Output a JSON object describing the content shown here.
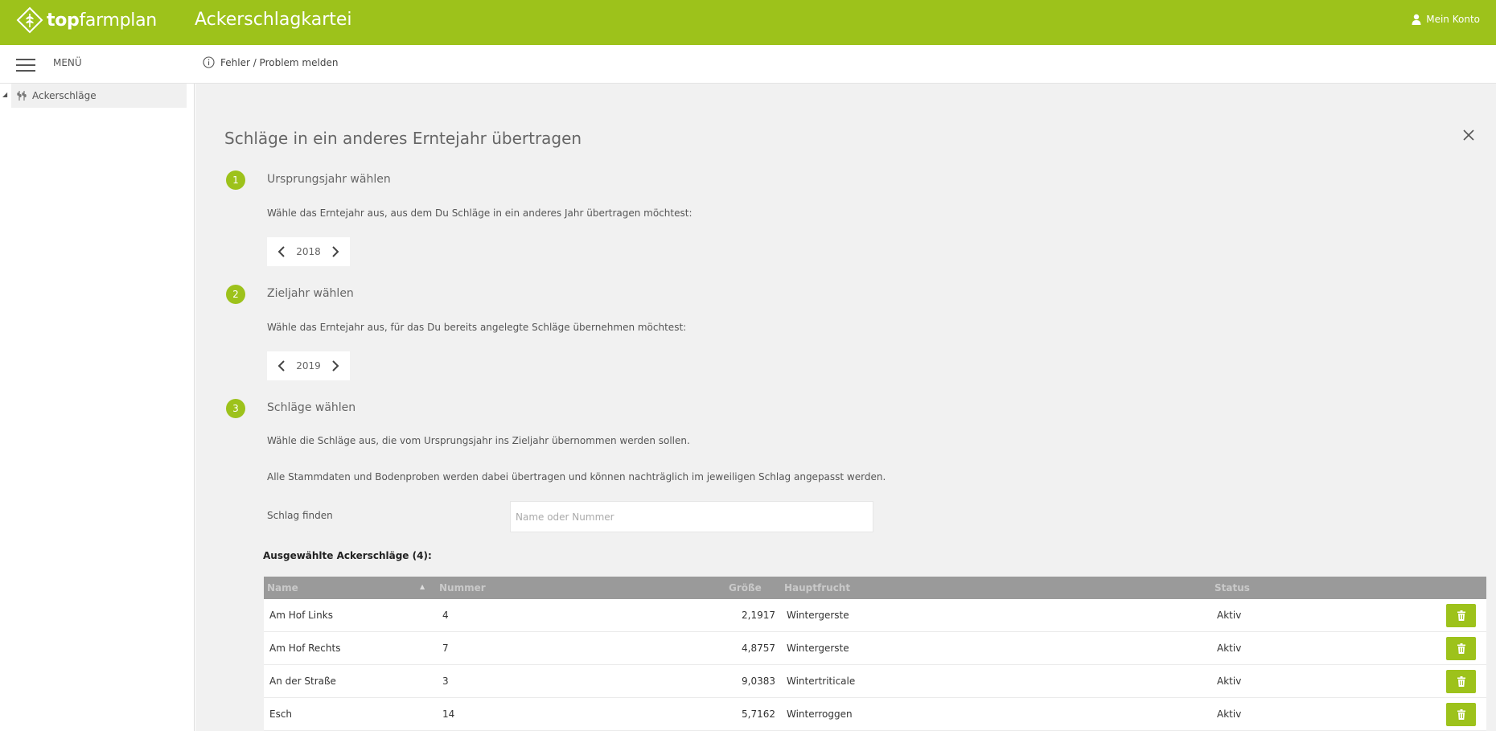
{
  "header": {
    "logo_text_bold": "top",
    "logo_text_light": "farmplan",
    "app_title": "Ackerschlagkartei",
    "account_label": "Mein Konto"
  },
  "subbar": {
    "menu_label": "MENÜ",
    "report_label": "Fehler / Problem melden"
  },
  "sidebar": {
    "items": [
      {
        "label": "Ackerschläge",
        "icon": "field-crop-icon"
      }
    ]
  },
  "panel": {
    "title": "Schläge in ein anderes Erntejahr übertragen",
    "steps": [
      {
        "number": "1",
        "title": "Ursprungsjahr wählen",
        "description": "Wähle das Erntejahr aus, aus dem Du Schläge in ein anderes Jahr übertragen möchtest:",
        "year": "2018"
      },
      {
        "number": "2",
        "title": "Zieljahr wählen",
        "description": "Wähle das Erntejahr aus, für das Du bereits angelegte Schläge übernehmen möchtest:",
        "year": "2019"
      },
      {
        "number": "3",
        "title": "Schläge wählen",
        "description": "Wähle die Schläge aus, die vom Ursprungsjahr ins Zieljahr übernommen werden sollen.",
        "description2": "Alle Stammdaten und Bodenproben werden dabei übertragen und können nachträglich im jeweiligen Schlag angepasst werden."
      }
    ],
    "find_label": "Schlag finden",
    "search_placeholder": "Name oder Nummer",
    "selected_label": "Ausgewählte Ackerschläge (4):"
  },
  "table": {
    "columns": [
      "Name",
      "Nummer",
      "Größe",
      "Hauptfrucht",
      "Status"
    ],
    "rows": [
      {
        "name": "Am Hof Links",
        "nummer": "4",
        "groesse": "2,1917",
        "hauptfrucht": "Wintergerste",
        "status": "Aktiv"
      },
      {
        "name": "Am Hof Rechts",
        "nummer": "7",
        "groesse": "4,8757",
        "hauptfrucht": "Wintergerste",
        "status": "Aktiv"
      },
      {
        "name": "An der Straße",
        "nummer": "3",
        "groesse": "9,0383",
        "hauptfrucht": "Wintertriticale",
        "status": "Aktiv"
      },
      {
        "name": "Esch",
        "nummer": "14",
        "groesse": "5,7162",
        "hauptfrucht": "Winterroggen",
        "status": "Aktiv"
      }
    ]
  },
  "colors": {
    "accent": "#9dc21b",
    "table_header": "#9a9a9a",
    "content_bg": "#f1f1f1"
  }
}
